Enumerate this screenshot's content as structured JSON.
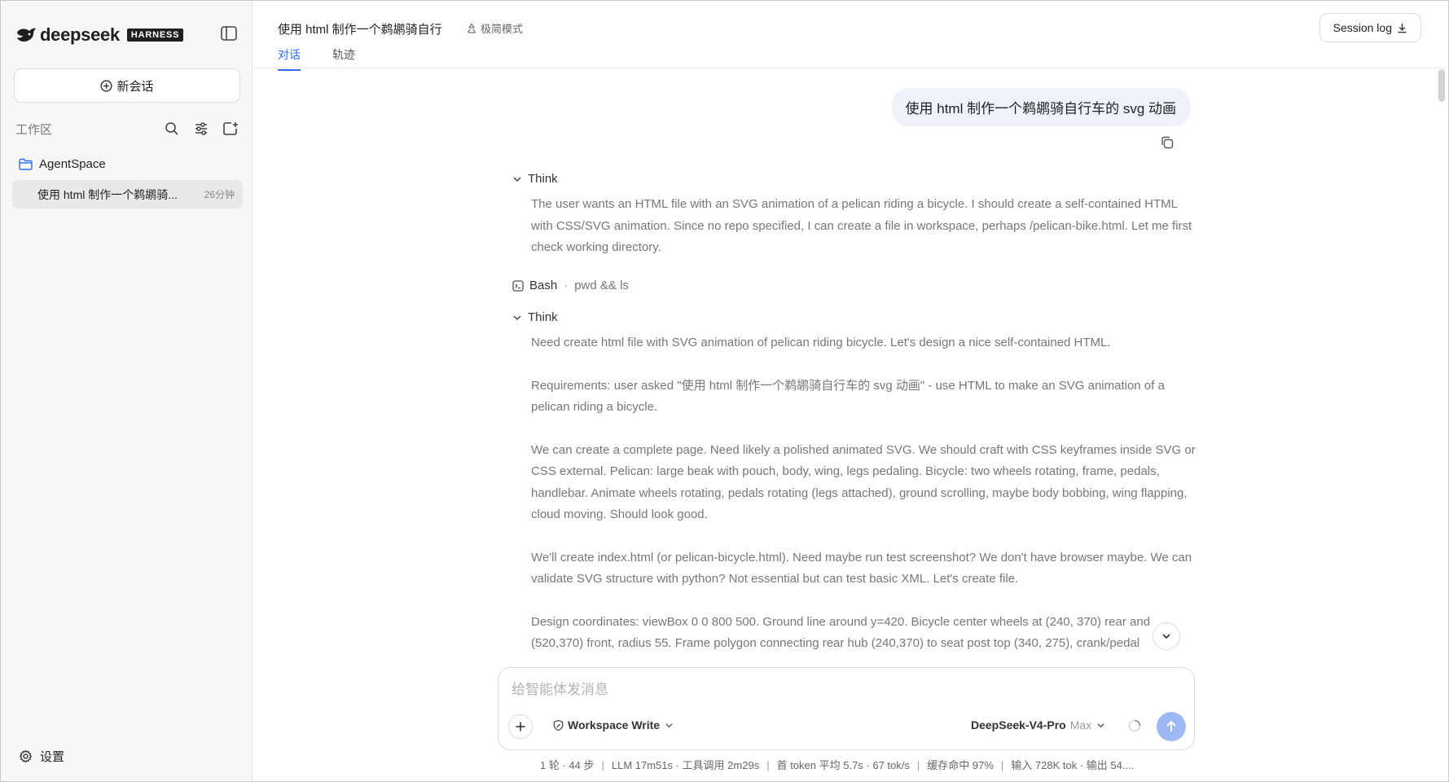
{
  "sidebar": {
    "brand": "deepseek",
    "badge": "HARNESS",
    "new_chat": "新会话",
    "workspace_label": "工作区",
    "folder": "AgentSpace",
    "session": {
      "title": "使用 html 制作一个鹈鹕骑...",
      "time": "26分钟"
    },
    "settings": "设置"
  },
  "header": {
    "title": "使用 html 制作一个鹈鹕骑自行",
    "mode": "极简模式",
    "tabs": [
      {
        "label": "对话"
      },
      {
        "label": "轨迹"
      }
    ],
    "session_log": "Session log"
  },
  "chat": {
    "user_message": "使用 html 制作一个鹈鹕骑自行车的 svg 动画",
    "think1": {
      "label": "Think",
      "paragraphs": [
        "The user wants an HTML file with an SVG animation of a pelican riding a bicycle. I should create a self-contained HTML with CSS/SVG animation. Since no repo specified, I can create a file in workspace, perhaps /pelican-bike.html. Let me first check working directory."
      ]
    },
    "tool": {
      "name": "Bash",
      "command": "pwd && ls"
    },
    "think2": {
      "label": "Think",
      "paragraphs": [
        "Need create html file with SVG animation of pelican riding bicycle. Let's design a nice self-contained HTML.",
        "Requirements: user asked \"使用 html 制作一个鹈鹕骑自行车的 svg 动画\" - use HTML to make an SVG animation of a pelican riding a bicycle.",
        "We can create a complete page. Need likely a polished animated SVG. We should craft with CSS keyframes inside SVG or CSS external. Pelican: large beak with pouch, body, wing, legs pedaling. Bicycle: two wheels rotating, frame, pedals, handlebar. Animate wheels rotating, pedals rotating (legs attached), ground scrolling, maybe body bobbing, wing flapping, cloud moving. Should look good.",
        "We'll create index.html (or pelican-bicycle.html). Need maybe run test screenshot? We don't have browser maybe. We can validate SVG structure with python? Not essential but can test basic XML. Let's create file.",
        "Design coordinates: viewBox 0 0 800 500. Ground line around y=420. Bicycle center wheels at (240, 370) rear and (520,370) front, radius 55. Frame polygon connecting rear hub (240,370) to seat post top (340, 275), crank/pedal"
      ]
    }
  },
  "composer": {
    "placeholder": "给智能体发消息",
    "value": "",
    "permission": "Workspace Write",
    "model": "DeepSeek-V4-Pro",
    "effort": "Max"
  },
  "stats": [
    "1 轮 · 44 步",
    "LLM 17m51s · 工具调用 2m29s",
    "首 token 平均 5.7s · 67 tok/s",
    "缓存命中 97%",
    "输入 728K tok · 输出 54...."
  ],
  "colors": {
    "accent": "#2b6cf0",
    "send_button": "#9cb8f5",
    "bubble": "#eef2fb"
  }
}
